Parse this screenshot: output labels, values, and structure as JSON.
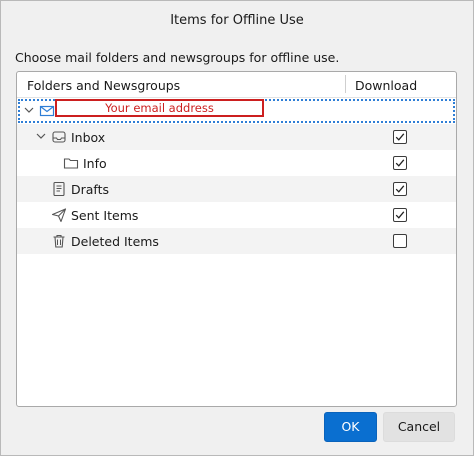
{
  "dialog": {
    "title": "Items for Offline Use",
    "instructions": "Choose mail folders and newsgroups for offline use."
  },
  "tree": {
    "columns": {
      "folders": "Folders and Newsgroups",
      "download": "Download"
    },
    "account": {
      "label": "Your email address",
      "icon": "mail-account-icon",
      "expanded": true
    },
    "items": [
      {
        "label": "Inbox",
        "icon": "inbox-icon",
        "checked": true,
        "expanded": true
      },
      {
        "label": "Info",
        "icon": "folder-icon",
        "checked": true
      },
      {
        "label": "Drafts",
        "icon": "drafts-icon",
        "checked": true
      },
      {
        "label": "Sent Items",
        "icon": "sent-icon",
        "checked": true
      },
      {
        "label": "Deleted Items",
        "icon": "trash-icon",
        "checked": false
      }
    ]
  },
  "buttons": {
    "ok": "OK",
    "cancel": "Cancel"
  },
  "colors": {
    "accent": "#0a6fd0",
    "redaction": "#cc1f1f",
    "selection_outline": "#2e7ed6"
  }
}
